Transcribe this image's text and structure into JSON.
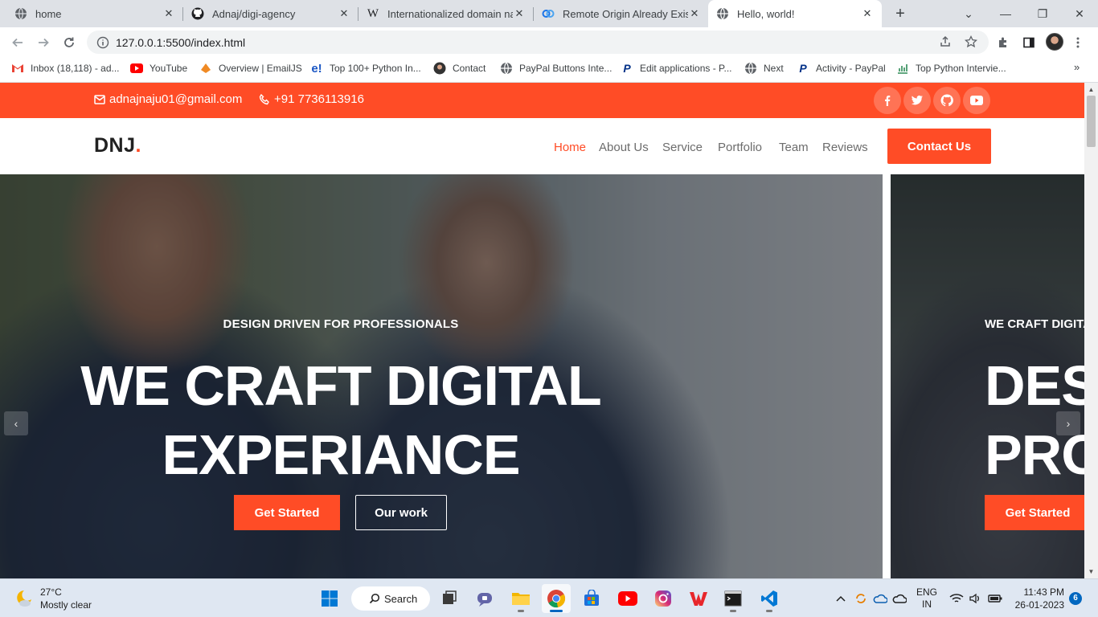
{
  "browser": {
    "tabs": [
      {
        "title": "home",
        "icon": "globe-icon",
        "active": false
      },
      {
        "title": "Adnaj/digi-agency",
        "icon": "github-icon",
        "active": false
      },
      {
        "title": "Internationalized domain nam",
        "icon": "wikipedia-icon",
        "active": false
      },
      {
        "title": "Remote Origin Already Exists",
        "icon": "link-icon",
        "active": false
      },
      {
        "title": "Hello, world!",
        "icon": "globe-icon",
        "active": true
      }
    ],
    "tab_close_glyph": "✕",
    "new_tab_glyph": "+",
    "window_controls": {
      "dropdown": "⌄",
      "minimize": "—",
      "restore": "❐",
      "close": "✕"
    },
    "url": "127.0.0.1:5500/index.html",
    "bookmarks": [
      {
        "label": "Inbox (18,118) - ad...",
        "icon": "gmail-icon"
      },
      {
        "label": "YouTube",
        "icon": "youtube-icon"
      },
      {
        "label": "Overview | EmailJS",
        "icon": "emailjs-icon"
      },
      {
        "label": "Top 100+ Python In...",
        "icon": "edureka-icon"
      },
      {
        "label": "Contact",
        "icon": "avatar-icon"
      },
      {
        "label": "PayPal Buttons Inte...",
        "icon": "globe-icon"
      },
      {
        "label": "Edit applications - P...",
        "icon": "paypal-icon"
      },
      {
        "label": "Next",
        "icon": "globe-icon"
      },
      {
        "label": "Activity - PayPal",
        "icon": "paypal-icon"
      },
      {
        "label": "Top Python Intervie...",
        "icon": "chart-icon"
      }
    ],
    "bookmarks_more": "»"
  },
  "site": {
    "colors": {
      "accent": "#ff4c26",
      "dark_text": "#212121",
      "nav_text": "#6c6c6c"
    },
    "topbar": {
      "email": "adnajnaju01@gmail.com",
      "phone": "+91 7736113916",
      "socials": [
        "facebook-icon",
        "twitter-icon",
        "github-icon",
        "youtube-icon"
      ]
    },
    "logo": {
      "text": "DNJ",
      "dot": "."
    },
    "nav": {
      "links": [
        "Home",
        "About Us",
        "Service",
        "Portfolio",
        "Team",
        "Reviews"
      ],
      "active_index": 0,
      "cta": "Contact Us"
    },
    "hero": {
      "slide1": {
        "subtitle": "DESIGN DRIVEN FOR PROFESSIONALS",
        "title_line1": "WE CRAFT DIGITAL",
        "title_line2": "EXPERIANCE",
        "primary_btn": "Get Started",
        "secondary_btn": "Our work"
      },
      "slide2": {
        "subtitle": "WE CRAFT DIGITA",
        "title_line1": "DES",
        "title_line2": "PRO",
        "primary_btn": "Get Started"
      },
      "prev_glyph": "‹",
      "next_glyph": "›"
    }
  },
  "taskbar": {
    "weather": {
      "temp": "27°C",
      "condition": "Mostly clear"
    },
    "search_label": "Search",
    "language": {
      "line1": "ENG",
      "line2": "IN"
    },
    "time": "11:43 PM",
    "date": "26-01-2023",
    "notifications": "6"
  }
}
